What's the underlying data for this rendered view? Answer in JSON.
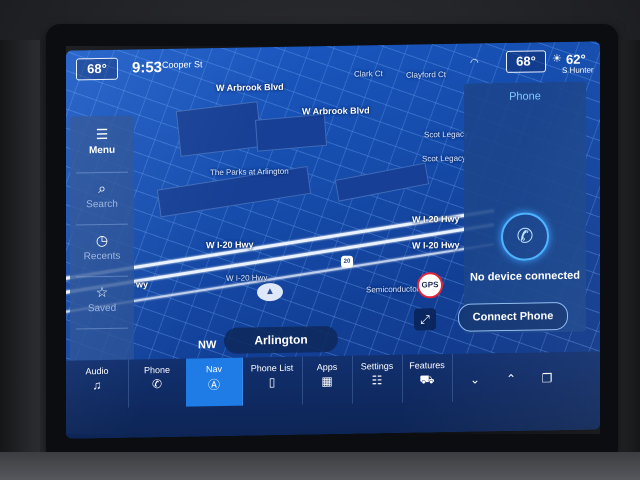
{
  "status": {
    "driver_temp": "68°",
    "time": "9:53",
    "street": "Cooper St",
    "passenger_temp": "68°",
    "outside_temp": "62°",
    "top_right_street": "S Hunter"
  },
  "map": {
    "labels": [
      "W Arbrook Blvd",
      "W Arbrook Blvd",
      "Clark Ct",
      "Clayford Ct",
      "Scot Legacy",
      "Scot Legacy",
      "The Parks at Arlington",
      "W I-20 Hwy",
      "W I-20 Hwy",
      "W I-20 Hwy",
      "W I-20 Hwy",
      "Semiconductor",
      "wy"
    ],
    "highway_shield": "20",
    "gps_label": "GPS",
    "heading": "NW",
    "city": "Arlington"
  },
  "side_menu": {
    "items": [
      {
        "label": "Menu",
        "icon": "☰"
      },
      {
        "label": "Search",
        "icon": "⌕"
      },
      {
        "label": "Recents",
        "icon": "◷"
      },
      {
        "label": "Saved",
        "icon": "☆"
      }
    ]
  },
  "phone_panel": {
    "title": "Phone",
    "status": "No device connected",
    "button": "Connect Phone",
    "icon": "✆"
  },
  "dock": {
    "items": [
      {
        "label": "Audio",
        "icon": "♫"
      },
      {
        "label": "Phone",
        "icon": "✆"
      },
      {
        "label": "Nav",
        "icon": "Ⓐ"
      },
      {
        "label": "Phone List",
        "icon": "▯"
      },
      {
        "label": "Apps",
        "icon": "▦"
      },
      {
        "label": "Settings",
        "icon": "☷"
      },
      {
        "label": "Features",
        "icon": "⛟"
      }
    ],
    "arrows": [
      "⌄",
      "⌃",
      "❐"
    ]
  }
}
